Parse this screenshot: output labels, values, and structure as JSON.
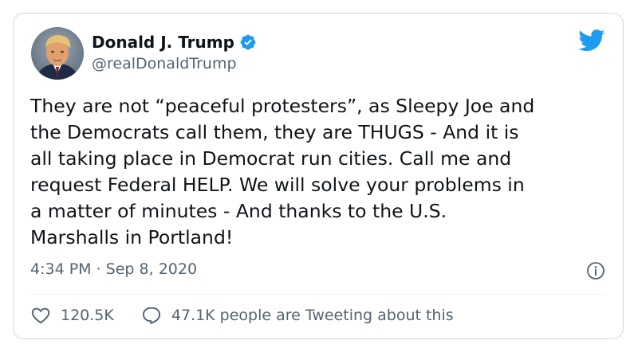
{
  "tweet": {
    "author": {
      "display_name": "Donald J. Trump",
      "handle": "@realDonaldTrump",
      "verified": true,
      "avatar_icon": "profile-photo"
    },
    "body_lines": [
      "They are not “peaceful protesters”, as Sleepy Joe and",
      "the Democrats call them, they are THUGS - And it is",
      "all taking place in Democrat run cities. Call me and",
      "request Federal HELP. We will solve your problems in",
      "a matter of minutes - And thanks to the U.S.",
      "Marshalls in Portland!"
    ],
    "timestamp": "4:34 PM · Sep 8, 2020",
    "likes": "120.5K",
    "conversation": "47.1K people are Tweeting about this"
  },
  "icons": {
    "brand": "twitter-bird-icon",
    "verified": "verified-badge-icon",
    "info": "info-icon",
    "like": "heart-icon",
    "reply": "speech-bubble-icon"
  },
  "colors": {
    "brand_blue": "#1d9bf0",
    "text": "#0f1419",
    "secondary_text": "#536471",
    "border": "#cfd9de"
  }
}
